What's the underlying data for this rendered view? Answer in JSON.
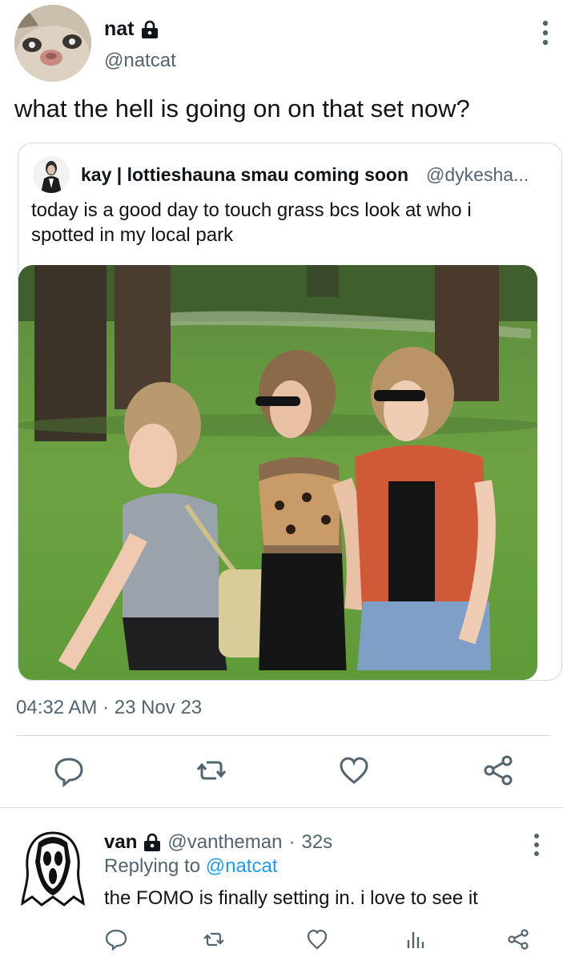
{
  "author": {
    "display_name": "nat",
    "handle": "@natcat",
    "avatar_icon": "cat-avatar"
  },
  "tweet": {
    "text": "what the hell is going on on that set now?",
    "timestamp": "04:32 AM · 23 Nov 23"
  },
  "quoted": {
    "display_name": "kay | lottieshauna smau coming soon",
    "handle": "@dykesha...",
    "text": "today is a good day to touch grass bcs look at who i spotted in my local park",
    "photo_icon": "park-photo"
  },
  "actions": [
    "reply-icon",
    "retweet-icon",
    "like-icon",
    "share-icon"
  ],
  "reply": {
    "display_name": "van",
    "handle": "@vantheman",
    "separator": "·",
    "time": "32s",
    "replying_prefix": "Replying to",
    "replying_handle": "@natcat",
    "text": "the FOMO is finally setting in. i love to see it",
    "avatar_icon": "ghostface-avatar",
    "actions": [
      "reply-icon",
      "retweet-icon",
      "like-icon",
      "views-icon",
      "share-icon"
    ]
  },
  "colors": {
    "text": "#0f1419",
    "secondary": "#536471",
    "link": "#1d9bf0",
    "border": "#cfd9de"
  }
}
